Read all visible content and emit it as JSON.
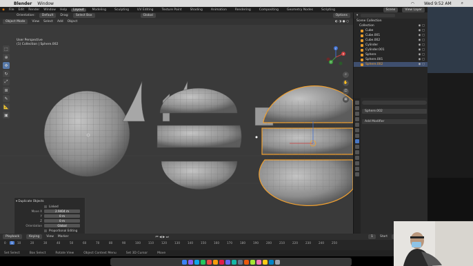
{
  "menubar": {
    "apple": "",
    "app": "Blender",
    "window": "Window",
    "clock": "Wed 9:52 AM"
  },
  "title": "Blender",
  "topbar": {
    "menus": [
      "File",
      "Edit",
      "Render",
      "Window",
      "Help"
    ],
    "tabs": [
      "Layout",
      "Modeling",
      "Sculpting",
      "UV Editing",
      "Texture Paint",
      "Shading",
      "Animation",
      "Rendering",
      "Compositing",
      "Geometry Nodes",
      "Scripting"
    ],
    "active_tab": "Layout",
    "scene": "Scene",
    "view_layer": "View Layer"
  },
  "tool_header": {
    "orientation_label": "Orientation:",
    "orientation": "Default",
    "drag_label": "Drag:",
    "drag": "Select Box",
    "transform": "Global",
    "options": "Options"
  },
  "view_header": {
    "mode": "Object Mode",
    "view": "View",
    "select": "Select",
    "add": "Add",
    "object": "Object"
  },
  "viewport": {
    "line1": "User Perspective",
    "line2": "(1) Collection | Sphere.002"
  },
  "gizmo": {
    "x": "X",
    "y": "Y",
    "z": "Z"
  },
  "operator_panel": {
    "title": "Duplicate Objects",
    "linked": "Linked",
    "move_x_label": "Move X",
    "move_x": "2.9404 m",
    "y_label": "Y",
    "y": "0 m",
    "z_label": "Z",
    "z": "0 m",
    "orientation_label": "Orientation",
    "orientation": "Global",
    "proportional": "Proportional Editing"
  },
  "timeline": {
    "playback": "Playback",
    "keying": "Keying",
    "view": "View",
    "marker": "Marker",
    "current": "1",
    "start_label": "Start",
    "start": "1",
    "end_label": "End",
    "end": "250",
    "ticks": [
      "0",
      "10",
      "20",
      "30",
      "40",
      "50",
      "60",
      "70",
      "80",
      "90",
      "100",
      "110",
      "120",
      "130",
      "140",
      "150",
      "160",
      "170",
      "180",
      "190",
      "200",
      "210",
      "220",
      "230",
      "240",
      "250"
    ]
  },
  "statusbar": {
    "select": "Set Select",
    "box": "Box Select",
    "rotate": "Rotate View",
    "menu": "Object Context Menu",
    "set_cursor": "Set 3D Cursor",
    "move": "Move"
  },
  "outliner": {
    "title": "Scene Collection",
    "collection": "Collection",
    "items": [
      "Cube",
      "Cube.001",
      "Cube.002",
      "Cylinder",
      "Cylinder.001",
      "Sphere",
      "Sphere.001",
      "Sphere.002"
    ],
    "selected": "Sphere.002"
  },
  "properties": {
    "object_name": "Sphere.002",
    "add_modifier": "Add Modifier"
  },
  "colors": {
    "selection": "#f0a030",
    "active_tab": "#4a78c4",
    "viewport": "#3a3a3a"
  }
}
